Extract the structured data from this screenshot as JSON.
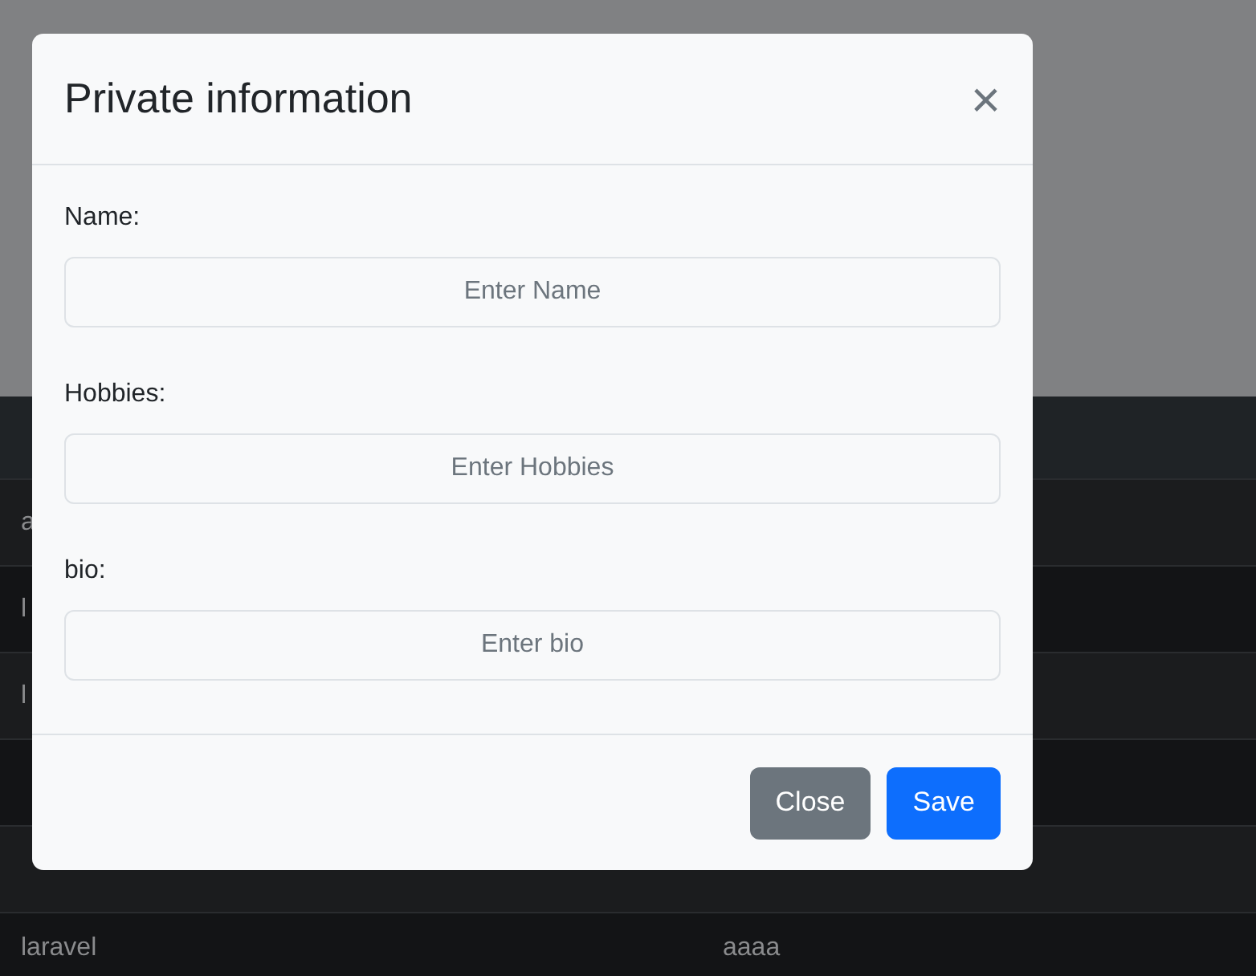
{
  "table": {
    "rows": [
      {
        "cells": [
          "a"
        ]
      },
      {
        "cells": [
          "l"
        ]
      },
      {
        "cells": [
          "l"
        ]
      },
      {
        "cells": []
      },
      {
        "cells": []
      },
      {
        "cells": [
          "laravel",
          "aaaa"
        ]
      }
    ]
  },
  "modal": {
    "title": "Private information",
    "close_icon": "×",
    "fields": [
      {
        "label": "Name:",
        "placeholder": "Enter Name"
      },
      {
        "label": "Hobbies:",
        "placeholder": "Enter Hobbies"
      },
      {
        "label": "bio:",
        "placeholder": "Enter bio"
      }
    ],
    "buttons": [
      {
        "label": "Close",
        "kind": "secondary"
      },
      {
        "label": "Save",
        "kind": "primary"
      }
    ]
  }
}
